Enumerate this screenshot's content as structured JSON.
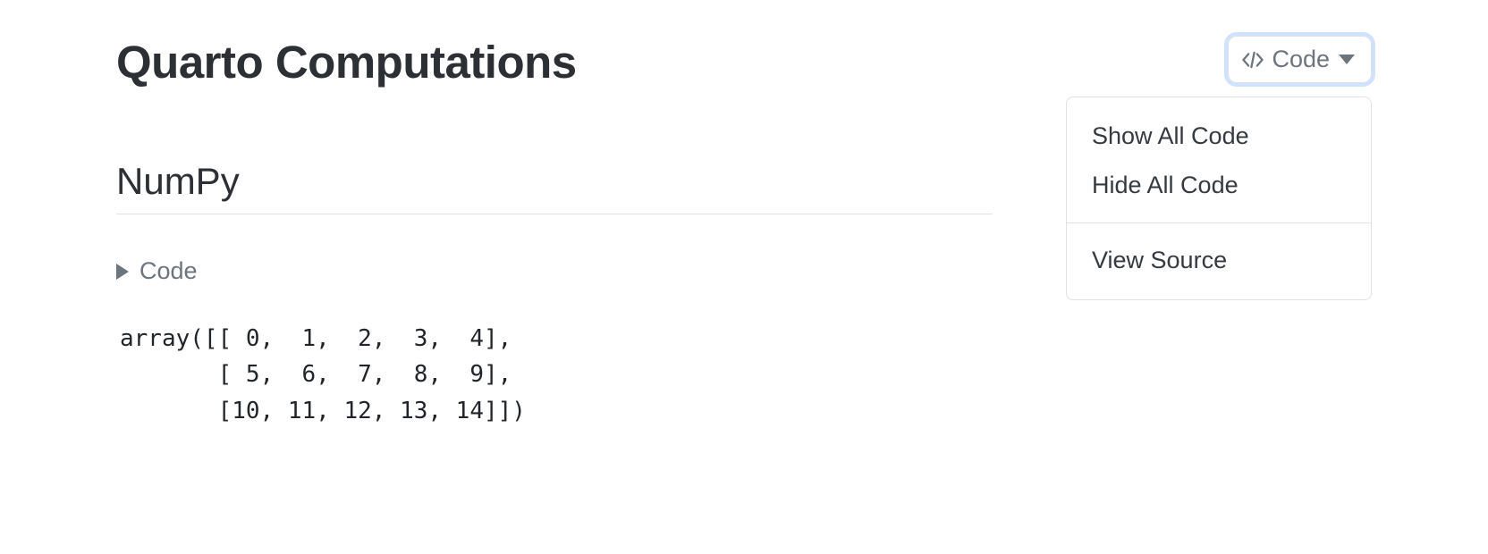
{
  "header": {
    "title": "Quarto Computations",
    "code_button_label": "Code",
    "dropdown": {
      "show_all": "Show All Code",
      "hide_all": "Hide All Code",
      "view_source": "View Source"
    }
  },
  "section": {
    "heading": "NumPy",
    "code_fold_label": "Code",
    "output": "array([[ 0,  1,  2,  3,  4],\n       [ 5,  6,  7,  8,  9],\n       [10, 11, 12, 13, 14]])"
  }
}
